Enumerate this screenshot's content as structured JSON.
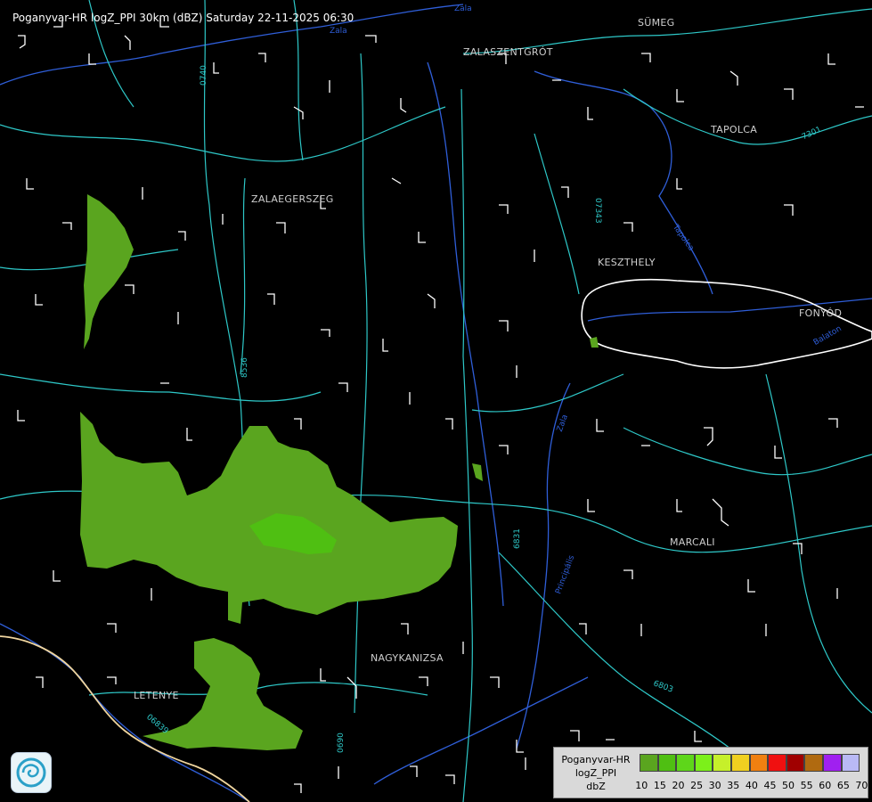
{
  "title": "Poganyvar-HR logZ_PPI 30km (dBZ) Saturday 22-11-2025 06:30",
  "cities": [
    {
      "id": "sumeg",
      "name": "SÜMEG"
    },
    {
      "id": "zalaszentgrot",
      "name": "ZALASZENTGRÓT"
    },
    {
      "id": "tapolca",
      "name": "TAPOLCA"
    },
    {
      "id": "zalaegerszeg",
      "name": "ZALAEGERSZEG"
    },
    {
      "id": "keszthely",
      "name": "KESZTHELY"
    },
    {
      "id": "fonyod",
      "name": "FONYÓD"
    },
    {
      "id": "marcali",
      "name": "MARCALI"
    },
    {
      "id": "nagykanizsa",
      "name": "NAGYKANIZSA"
    },
    {
      "id": "letenye",
      "name": "LETENYE"
    }
  ],
  "road_labels": [
    "0740",
    "07343",
    "7301",
    "8536",
    "6831",
    "6803",
    "06839",
    "0690"
  ],
  "river_labels": [
    "Zala",
    "Tapolca",
    "Zala",
    "Balaton",
    "Zala",
    "Principális"
  ],
  "legend": {
    "name_lines": [
      "Poganyvar-HR",
      "logZ_PPI",
      "dbZ"
    ],
    "ticks": [
      "10",
      "15",
      "20",
      "25",
      "30",
      "35",
      "40",
      "45",
      "50",
      "55",
      "60",
      "65",
      "70"
    ],
    "colors": [
      "#5aa51f",
      "#4fbf12",
      "#5ed61a",
      "#7cf01a",
      "#c6f02a",
      "#f0d020",
      "#f08010",
      "#f01010",
      "#a00000",
      "#b06a10",
      "#a020f0",
      "#b9b9f5"
    ]
  },
  "colors": {
    "background": "#000000",
    "roads": "#2ec8c8",
    "rivers": "#2f5ed8",
    "borders": "#ffffff",
    "echo_low": "#5aa51f",
    "echo_mid": "#4fbf12"
  }
}
